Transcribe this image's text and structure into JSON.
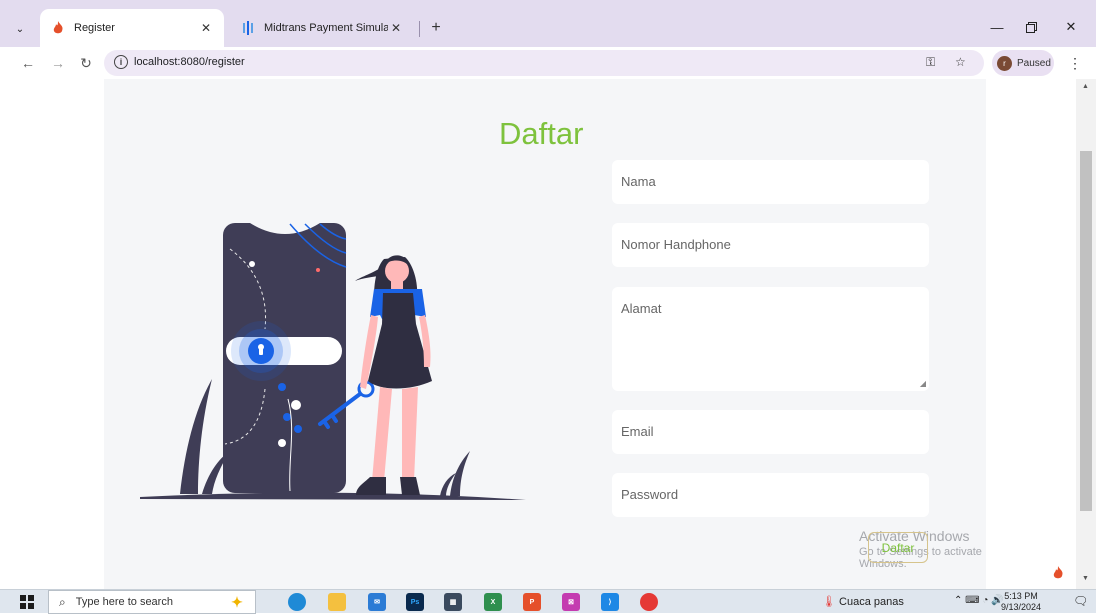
{
  "browser": {
    "tabs": [
      {
        "title": "Register",
        "active": true
      },
      {
        "title": "Midtrans Payment Simulator",
        "active": false
      }
    ],
    "url": "localhost:8080/register",
    "profile_status": "Paused",
    "profile_initial": "r"
  },
  "page": {
    "heading": "Daftar",
    "fields": {
      "nama_placeholder": "Nama",
      "hp_placeholder": "Nomor Handphone",
      "alamat_placeholder": "Alamat",
      "email_placeholder": "Email",
      "password_placeholder": "Password"
    },
    "submit_label": "Daftar"
  },
  "watermark": {
    "line1": "Activate Windows",
    "line2": "Go to Settings to activate Windows."
  },
  "taskbar": {
    "search_placeholder": "Type here to search",
    "weather": "Cuaca panas",
    "time": "5:13 PM",
    "date": "9/13/2024"
  },
  "colors": {
    "accent": "#7ec23d",
    "illustration_dark": "#3f3d56",
    "illustration_blue": "#1a63e6"
  }
}
